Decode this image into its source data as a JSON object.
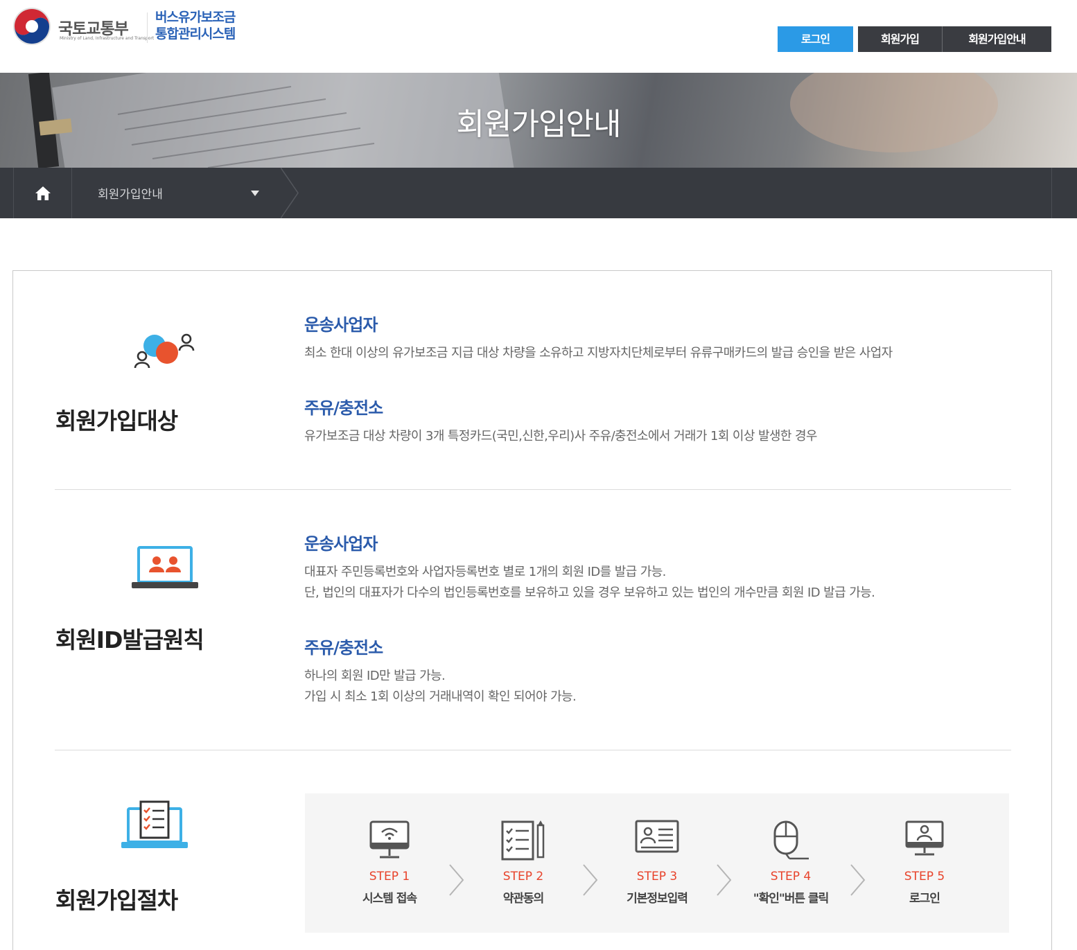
{
  "header": {
    "ministry_name": "국토교통부",
    "ministry_name_en": "Ministry of Land, Infrastructure and Transport",
    "system_name_line1": "버스유가보조금",
    "system_name_line2": "통합관리시스템",
    "nav": {
      "login": "로그인",
      "join": "회원가입",
      "join_guide": "회원가입안내"
    }
  },
  "banner": {
    "title": "회원가입안내"
  },
  "breadcrumb": {
    "current": "회원가입안내"
  },
  "sections": {
    "target": {
      "title": "회원가입대상",
      "items": [
        {
          "subtitle": "운송사업자",
          "lines": [
            "최소 한대 이상의 유가보조금 지급 대상 차량을 소유하고 지방자치단체로부터 유류구매카드의 발급 승인을 받은 사업자"
          ]
        },
        {
          "subtitle": "주유/충전소",
          "lines": [
            "유가보조금 대상 차량이 3개 특정카드(국민,신한,우리)사 주유/충전소에서 거래가 1회 이상 발생한 경우"
          ]
        }
      ]
    },
    "id_policy": {
      "title": "회원ID발급원칙",
      "items": [
        {
          "subtitle": "운송사업자",
          "lines": [
            "대표자 주민등록번호와 사업자등록번호 별로 1개의 회원 ID를 발급 가능.",
            "단, 법인의 대표자가 다수의 법인등록번호를 보유하고 있을 경우 보유하고 있는 법인의 개수만큼 회원 ID 발급 가능."
          ]
        },
        {
          "subtitle": "주유/충전소",
          "lines": [
            "하나의 회원 ID만 발급 가능.",
            "가입 시 최소 1회 이상의 거래내역이 확인 되어야 가능."
          ]
        }
      ]
    },
    "procedure": {
      "title": "회원가입절차",
      "steps": [
        {
          "num": "STEP 1",
          "label": "시스템 접속",
          "icon": "monitor-wifi-icon"
        },
        {
          "num": "STEP 2",
          "label": "약관동의",
          "icon": "checklist-pen-icon"
        },
        {
          "num": "STEP 3",
          "label": "기본정보입력",
          "icon": "id-card-icon"
        },
        {
          "num": "STEP 4",
          "label": "\"확인\"버튼 클릭",
          "icon": "mouse-icon"
        },
        {
          "num": "STEP 5",
          "label": "로그인",
          "icon": "monitor-user-icon"
        }
      ]
    }
  },
  "colors": {
    "accent_blue": "#2b9ae6",
    "heading_blue": "#2b5bab",
    "step_red": "#e8432b",
    "dark_bar": "#373a40"
  }
}
